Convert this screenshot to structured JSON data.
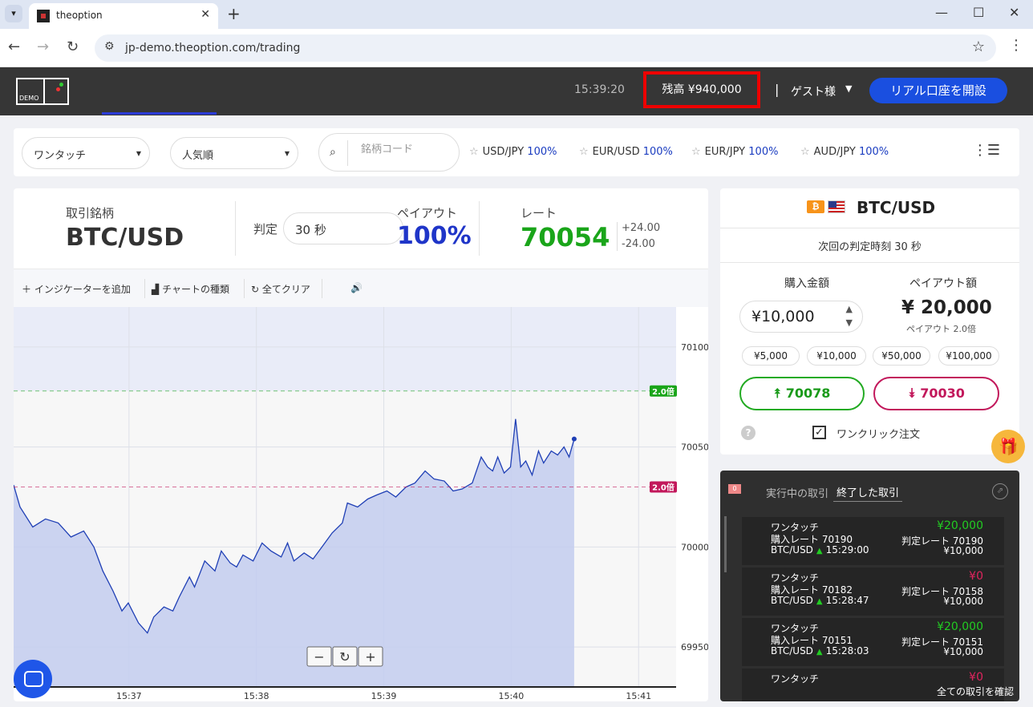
{
  "browser": {
    "tab_title": "theoption",
    "url": "jp-demo.theoption.com/trading"
  },
  "header": {
    "logo_text": "DEMO",
    "time": "15:39:20",
    "balance": "残高 ¥940,000",
    "separator": "|",
    "guest": "ゲスト様",
    "open_account": "リアル口座を開設"
  },
  "filters": {
    "mode": "ワンタッチ",
    "sort": "人気順",
    "search_placeholder": "銘柄コード",
    "favorites": [
      {
        "pair": "USD/JPY",
        "payout": "100%"
      },
      {
        "pair": "EUR/USD",
        "payout": "100%"
      },
      {
        "pair": "EUR/JPY",
        "payout": "100%"
      },
      {
        "pair": "AUD/JPY",
        "payout": "100%"
      }
    ]
  },
  "trade_info": {
    "symbol_label": "取引銘柄",
    "symbol": "BTC/USD",
    "judge_label": "判定",
    "judge_value": "30 秒",
    "payout_label": "ペイアウト",
    "payout": "100%",
    "rate_label": "レート",
    "rate": "70054",
    "rate_up": "+24.00",
    "rate_down": "-24.00"
  },
  "toolbar": {
    "add_indicator": "インジケーターを追加",
    "chart_type": "チャートの種類",
    "clear_all": "全てクリア"
  },
  "chart_data": {
    "type": "line",
    "x_ticks": [
      "15:37",
      "15:38",
      "15:39",
      "15:40",
      "15:41"
    ],
    "y_ticks": [
      70100,
      70050,
      70000,
      69950
    ],
    "ylim": [
      69930,
      70120
    ],
    "upper_barrier": {
      "value": 70078,
      "label": "2.0倍"
    },
    "lower_barrier": {
      "value": 70030,
      "label": "2.0倍"
    },
    "colors": {
      "line": "#1f3fb5",
      "fill": "#c3cdee",
      "upper": "#1aa51a",
      "lower": "#c2185b"
    },
    "x_range_min": [
      0,
      5.2
    ],
    "points": [
      [
        0,
        70031
      ],
      [
        0.05,
        70020
      ],
      [
        0.15,
        70010
      ],
      [
        0.25,
        70014
      ],
      [
        0.35,
        70012
      ],
      [
        0.45,
        70005
      ],
      [
        0.55,
        70008
      ],
      [
        0.63,
        70000
      ],
      [
        0.7,
        69988
      ],
      [
        0.78,
        69978
      ],
      [
        0.85,
        69968
      ],
      [
        0.9,
        69972
      ],
      [
        0.98,
        69962
      ],
      [
        1.05,
        69957
      ],
      [
        1.1,
        69965
      ],
      [
        1.18,
        69970
      ],
      [
        1.25,
        69968
      ],
      [
        1.3,
        69975
      ],
      [
        1.38,
        69985
      ],
      [
        1.42,
        69980
      ],
      [
        1.5,
        69993
      ],
      [
        1.58,
        69988
      ],
      [
        1.63,
        69998
      ],
      [
        1.7,
        69992
      ],
      [
        1.75,
        69990
      ],
      [
        1.8,
        69996
      ],
      [
        1.88,
        69993
      ],
      [
        1.95,
        70002
      ],
      [
        2.02,
        69998
      ],
      [
        2.1,
        69995
      ],
      [
        2.15,
        70002
      ],
      [
        2.2,
        69993
      ],
      [
        2.28,
        69997
      ],
      [
        2.35,
        69994
      ],
      [
        2.42,
        70000
      ],
      [
        2.5,
        70007
      ],
      [
        2.58,
        70012
      ],
      [
        2.62,
        70022
      ],
      [
        2.7,
        70020
      ],
      [
        2.78,
        70024
      ],
      [
        2.85,
        70026
      ],
      [
        2.93,
        70028
      ],
      [
        3.0,
        70025
      ],
      [
        3.08,
        70030
      ],
      [
        3.15,
        70032
      ],
      [
        3.23,
        70038
      ],
      [
        3.3,
        70034
      ],
      [
        3.38,
        70033
      ],
      [
        3.45,
        70028
      ],
      [
        3.52,
        70029
      ],
      [
        3.6,
        70032
      ],
      [
        3.67,
        70045
      ],
      [
        3.72,
        70040
      ],
      [
        3.76,
        70038
      ],
      [
        3.8,
        70045
      ],
      [
        3.85,
        70037
      ],
      [
        3.9,
        70040
      ],
      [
        3.94,
        70064
      ],
      [
        3.98,
        70040
      ],
      [
        4.02,
        70043
      ],
      [
        4.07,
        70036
      ],
      [
        4.12,
        70048
      ],
      [
        4.16,
        70042
      ],
      [
        4.22,
        70048
      ],
      [
        4.27,
        70046
      ],
      [
        4.32,
        70050
      ],
      [
        4.36,
        70045
      ],
      [
        4.4,
        70054
      ]
    ],
    "zoom": {
      "minus": "−",
      "reset": "↻",
      "plus": "+"
    }
  },
  "order_panel": {
    "symbol": "BTC/USD",
    "next_judge": "次回の判定時刻 30 秒",
    "purchase_label": "購入金額",
    "payout_label": "ペイアウト額",
    "amount": "¥10,000",
    "payout_amount": "¥ 20,000",
    "payout_multiplier": "ペイアウト 2.0倍",
    "quick_amounts": [
      "¥5,000",
      "¥10,000",
      "¥50,000",
      "¥100,000"
    ],
    "up_price": "70078",
    "down_price": "70030",
    "help": "?",
    "one_click": "ワンクリック注文"
  },
  "trades": {
    "badge": "0",
    "tab_active": "実行中の取引",
    "tab_closed": "終了した取引",
    "items": [
      {
        "type": "ワンタッチ",
        "buy_rate": "購入レート 70190",
        "pair": "BTC/USD",
        "time": "15:29:00",
        "result": "¥20,000",
        "result_color": "#22cc22",
        "judge_rate": "判定レート 70190",
        "stake": "¥10,000"
      },
      {
        "type": "ワンタッチ",
        "buy_rate": "購入レート 70182",
        "pair": "BTC/USD",
        "time": "15:28:47",
        "result": "¥0",
        "result_color": "#e0245e",
        "judge_rate": "判定レート 70158",
        "stake": "¥10,000"
      },
      {
        "type": "ワンタッチ",
        "buy_rate": "購入レート 70151",
        "pair": "BTC/USD",
        "time": "15:28:03",
        "result": "¥20,000",
        "result_color": "#22cc22",
        "judge_rate": "判定レート 70151",
        "stake": "¥10,000"
      },
      {
        "type": "ワンタッチ",
        "result": "¥0",
        "result_color": "#e0245e"
      }
    ],
    "view_all": "全ての取引を確認"
  }
}
